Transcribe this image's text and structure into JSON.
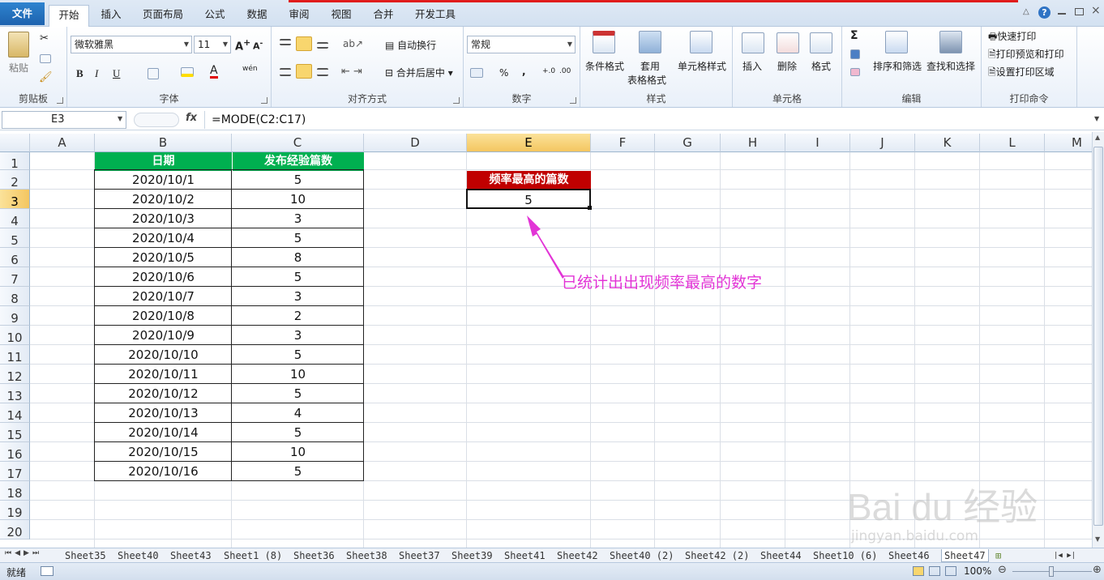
{
  "ribbon_tabs": [
    "文件",
    "开始",
    "插入",
    "页面布局",
    "公式",
    "数据",
    "审阅",
    "视图",
    "合并",
    "开发工具"
  ],
  "clipboard": {
    "paste": "粘贴",
    "label": "剪贴板"
  },
  "font": {
    "name": "微软雅黑",
    "size": "11",
    "bold": "B",
    "italic": "I",
    "underline": "U",
    "wen": "wén",
    "label": "字体"
  },
  "alignment": {
    "wrap": "自动换行",
    "merge": "合并后居中",
    "label": "对齐方式"
  },
  "number": {
    "format": "常规",
    "percent": "%",
    "comma": ",",
    "inc": "+.0",
    "dec": ".00",
    "label": "数字"
  },
  "styles": {
    "cond": "条件格式",
    "table1": "套用",
    "table2": "表格格式",
    "cell": "单元格样式",
    "label": "样式"
  },
  "cells": {
    "insert": "插入",
    "delete": "删除",
    "format": "格式",
    "label": "单元格"
  },
  "editing": {
    "sigma": "Σ",
    "sort": "排序和筛选",
    "find": "查找和选择",
    "label": "编辑"
  },
  "print": {
    "quick": "快速打印",
    "preview": "打印预览和打印",
    "area": "设置打印区域",
    "label": "打印命令"
  },
  "formula_bar": {
    "name_box": "E3",
    "fx": "fx",
    "formula": "=MODE(C2:C17)"
  },
  "columns": [
    "A",
    "B",
    "C",
    "D",
    "E",
    "F",
    "G",
    "H",
    "I",
    "J",
    "K",
    "L",
    "M"
  ],
  "rows": [
    "1",
    "2",
    "3",
    "4",
    "5",
    "6",
    "7",
    "8",
    "9",
    "10",
    "11",
    "12",
    "13",
    "14",
    "15",
    "16",
    "17",
    "18",
    "19",
    "20"
  ],
  "table": {
    "headers": [
      "日期",
      "发布经验篇数"
    ],
    "rows": [
      [
        "2020/10/1",
        "5"
      ],
      [
        "2020/10/2",
        "10"
      ],
      [
        "2020/10/3",
        "3"
      ],
      [
        "2020/10/4",
        "5"
      ],
      [
        "2020/10/5",
        "8"
      ],
      [
        "2020/10/6",
        "5"
      ],
      [
        "2020/10/7",
        "3"
      ],
      [
        "2020/10/8",
        "2"
      ],
      [
        "2020/10/9",
        "3"
      ],
      [
        "2020/10/10",
        "5"
      ],
      [
        "2020/10/11",
        "10"
      ],
      [
        "2020/10/12",
        "5"
      ],
      [
        "2020/10/13",
        "4"
      ],
      [
        "2020/10/14",
        "5"
      ],
      [
        "2020/10/15",
        "10"
      ],
      [
        "2020/10/16",
        "5"
      ]
    ]
  },
  "result": {
    "header": "频率最高的篇数",
    "value": "5"
  },
  "annotation": "已统计出出现频率最高的数字",
  "sheet_tabs": [
    "Sheet35",
    "Sheet40",
    "Sheet43",
    "Sheet1 (8)",
    "Sheet36",
    "Sheet38",
    "Sheet37",
    "Sheet39",
    "Sheet41",
    "Sheet42",
    "Sheet40 (2)",
    "Sheet42 (2)",
    "Sheet44",
    "Sheet10 (6)",
    "Sheet46",
    "Sheet47"
  ],
  "active_sheet": "Sheet47",
  "status": {
    "ready": "就绪",
    "zoom": "100%"
  },
  "watermark": {
    "brand": "Bai du 经验",
    "url": "jingyan.baidu.com"
  },
  "colors": {
    "header_green": "#00b050",
    "result_red": "#c00000",
    "annotation": "#e234d6",
    "selection": "#f4c660"
  }
}
